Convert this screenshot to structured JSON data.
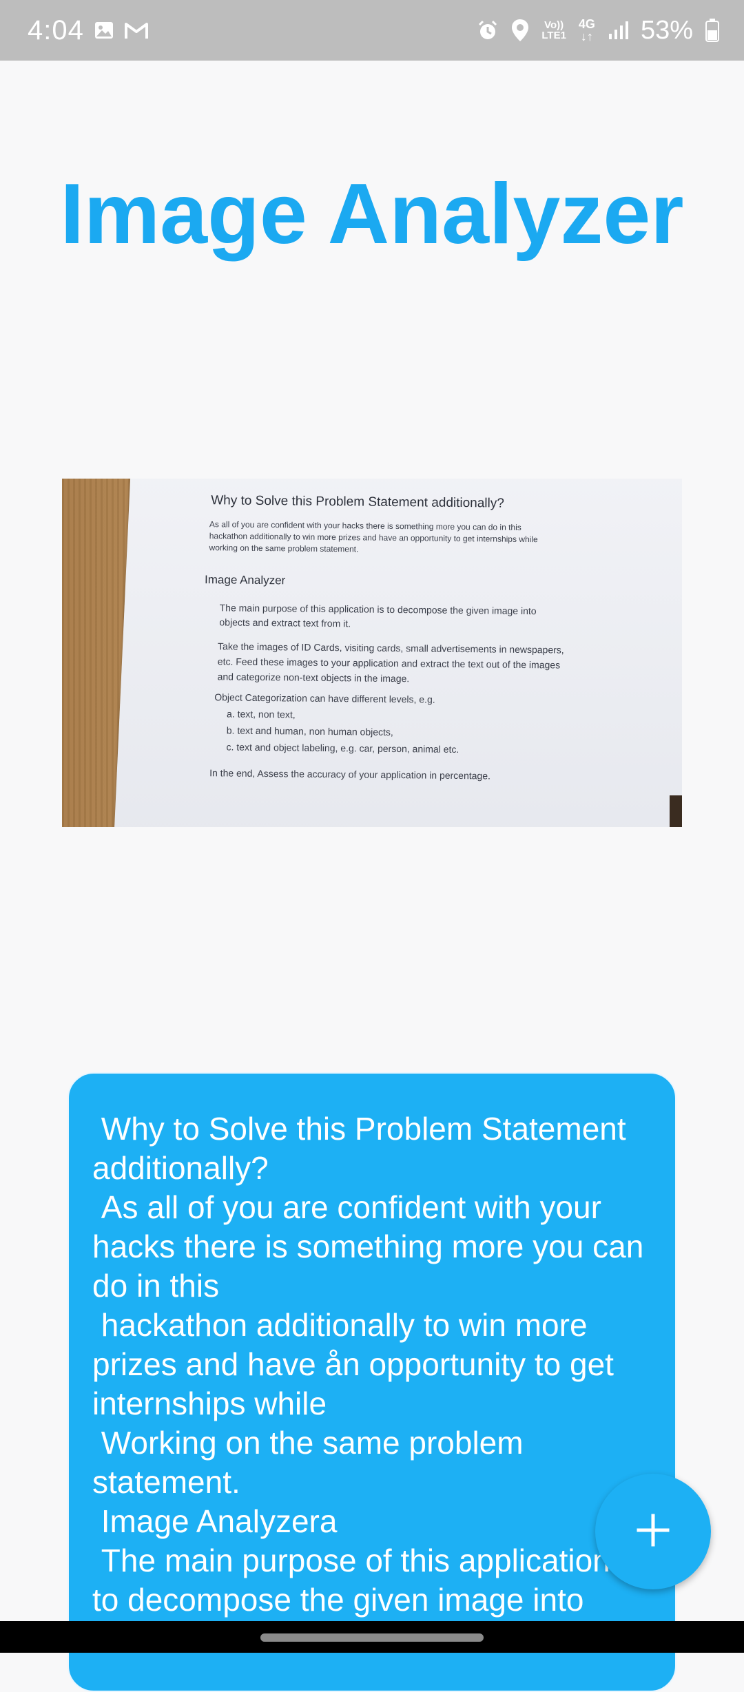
{
  "status_bar": {
    "time": "4:04",
    "notification_icons": [
      "image-icon",
      "gmail-icon"
    ],
    "system_icons": [
      "alarm-icon",
      "location-icon",
      "volte-indicator",
      "4g-indicator",
      "signal-icon"
    ],
    "volte_top": "Vo))",
    "volte_bottom": "LTE1",
    "net_top": "4G",
    "net_bottom": "↓↑",
    "battery_percent": "53%",
    "color": "#bdbdbd"
  },
  "app": {
    "title": "Image Analyzer",
    "accent_color": "#1ba9f1"
  },
  "photo": {
    "heading": "Why to Solve this Problem Statement additionally?",
    "para1_line1": "As all of you are confident with your hacks there is something more you can do in this",
    "para1_line2": "hackathon additionally to win more prizes and have an opportunity to get internships while",
    "para1_line3": "working on the same problem statement.",
    "subheading": "Image Analyzer",
    "para2_line1": "The main purpose of this application is to decompose the given image into",
    "para2_line2": "objects and extract text from it.",
    "para3_line1": "Take the images of ID Cards, visiting cards, small advertisements in newspapers,",
    "para3_line2": "etc. Feed these images to your application and extract the text out of the images",
    "para3_line3": "and categorize non-text objects in the image.",
    "para4": "Object Categorization can have different levels, e.g.",
    "list_a": "a.  text, non text,",
    "list_b": "b.  text and human, non human objects,",
    "list_c": "c.  text and object labeling, e.g. car, person, animal etc.",
    "closing": "In the end, Assess the accuracy of your application in percentage."
  },
  "result_card": {
    "extracted_text": " Why to Solve this Problem Statement additionally?\n As all of you are confident with your hacks there is something more you can do in this\n hackathon additionally to win more prizes and have ån opportunity to get internships while\n Working on the same problem statement.\n Image Analyzera\n The main purpose of this application is to decompose the given image into",
    "background_color": "#1db0f4"
  },
  "fab": {
    "icon": "plus-icon"
  },
  "nav_bar": {
    "handle": "gesture-handle"
  }
}
